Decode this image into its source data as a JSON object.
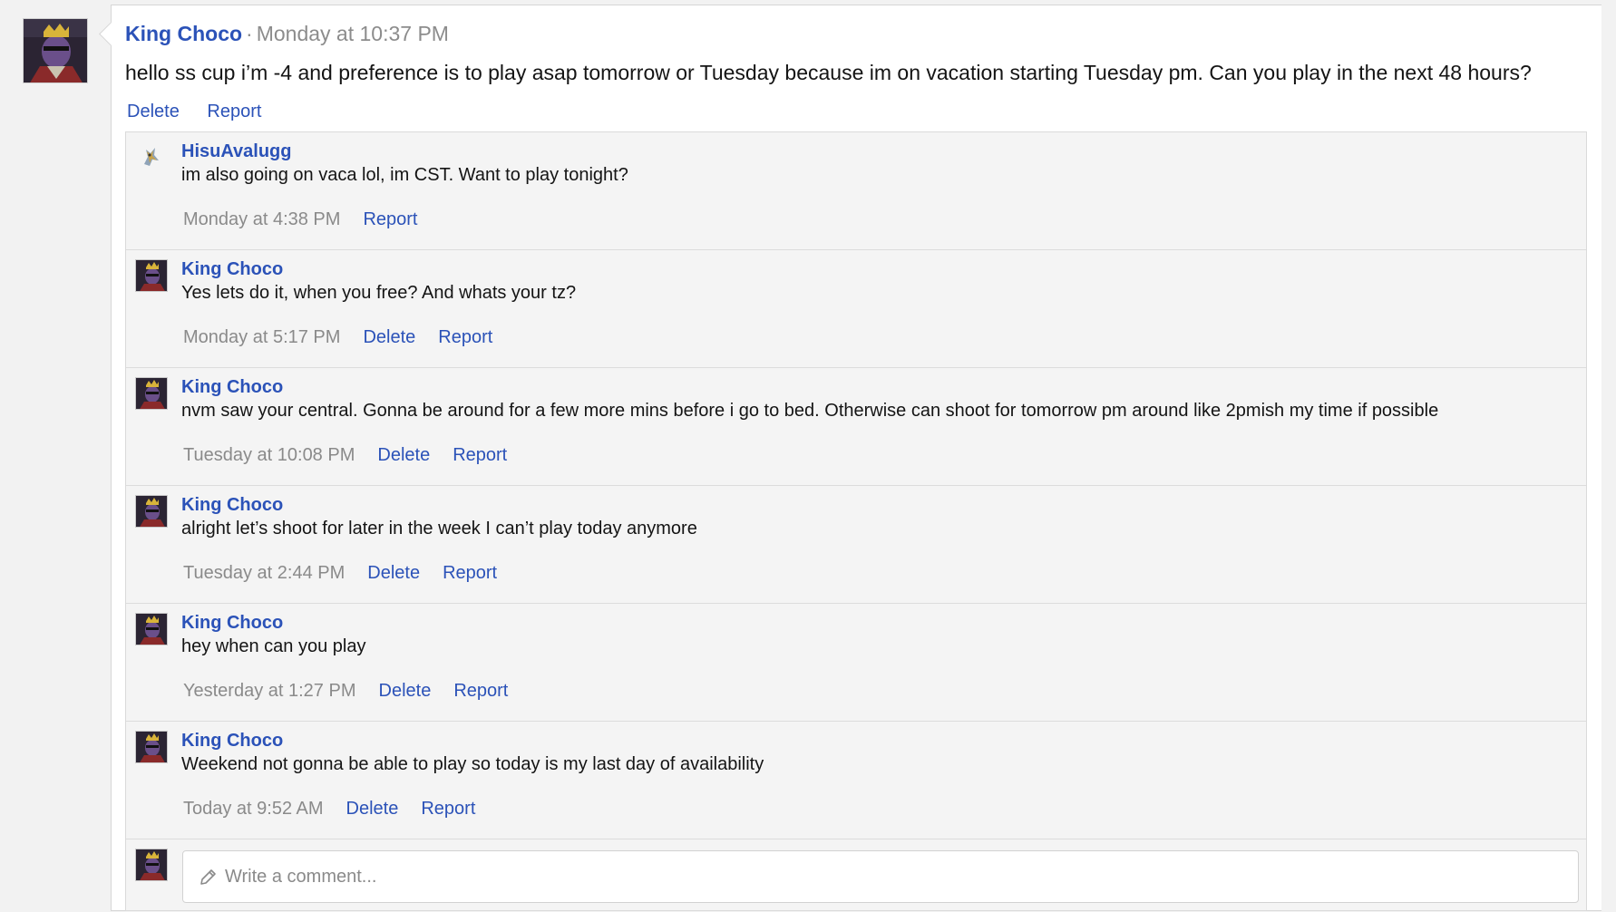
{
  "post": {
    "author": "King Choco",
    "separator": "·",
    "time": "Monday at 10:37 PM",
    "text": "hello ss cup i’m -4 and preference is to play asap tomorrow or Tuesday because im on vacation starting Tuesday pm. Can you play in the next 48 hours?",
    "actions": {
      "delete": "Delete",
      "report": "Report"
    }
  },
  "comments": [
    {
      "author": "HisuAvalugg",
      "text": "im also going on vaca lol, im CST. Want to play tonight?",
      "time": "Monday at 4:38 PM",
      "delete": "",
      "report": "Report"
    },
    {
      "author": "King Choco",
      "text": "Yes lets do it, when you free? And whats your tz?",
      "time": "Monday at 5:17 PM",
      "delete": "Delete",
      "report": "Report"
    },
    {
      "author": "King Choco",
      "text": "nvm saw your central. Gonna be around for a few more mins before i go to bed. Otherwise can shoot for tomorrow pm around like 2pmish my time if possible",
      "time": "Tuesday at 10:08 PM",
      "delete": "Delete",
      "report": "Report"
    },
    {
      "author": "King Choco",
      "text": "alright let’s shoot for later in the week I can’t play today anymore",
      "time": "Tuesday at 2:44 PM",
      "delete": "Delete",
      "report": "Report"
    },
    {
      "author": "King Choco",
      "text": "hey when can you play",
      "time": "Yesterday at 1:27 PM",
      "delete": "Delete",
      "report": "Report"
    },
    {
      "author": "King Choco",
      "text": "Weekend not gonna be able to play so today is my last day of availability",
      "time": "Today at 9:52 AM",
      "delete": "Delete",
      "report": "Report"
    }
  ],
  "comment_input": {
    "placeholder": "Write a comment..."
  },
  "icons": {
    "pencil": "pencil-icon",
    "avatar": "user-avatar",
    "alt_avatar": "pokemon-avatar"
  }
}
